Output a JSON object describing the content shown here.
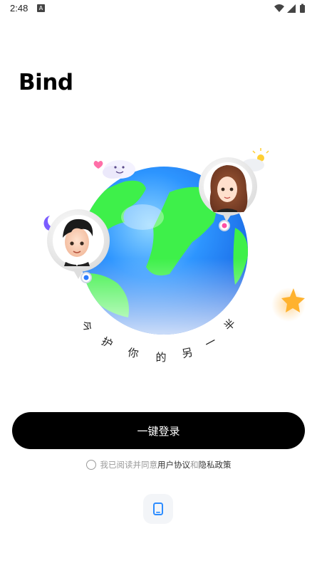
{
  "status_bar": {
    "time": "2:48",
    "notification_badge": "A",
    "icons": [
      "wifi-icon",
      "signal-icon",
      "battery-icon"
    ]
  },
  "app": {
    "logo_text": "Bind"
  },
  "hero": {
    "slogan_chars": [
      "今",
      "护",
      "你",
      "的",
      "另",
      "一",
      "半"
    ]
  },
  "login": {
    "button_label": "一键登录"
  },
  "agreement": {
    "prefix": "我已阅读并同意",
    "user_agreement": "用户协议",
    "conjunction": "和",
    "privacy_policy": "隐私政策"
  },
  "alt_login": {
    "icon": "phone-icon"
  },
  "colors": {
    "primary_button": "#000000",
    "ocean": "#1f8fff",
    "land": "#3ef04a",
    "pin_pink": "#ff4fa3",
    "pin_blue": "#2b7bff",
    "star": "#ffb22e",
    "alt_login_icon": "#2c8cff"
  }
}
